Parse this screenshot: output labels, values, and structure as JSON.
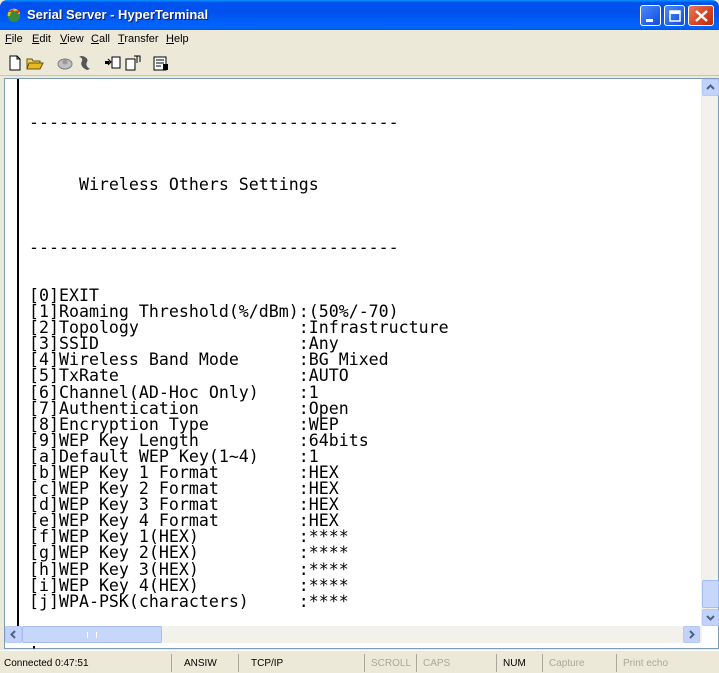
{
  "window": {
    "title": "Serial Server - HyperTerminal",
    "controls": [
      "minimize",
      "maximize",
      "close"
    ]
  },
  "menu": {
    "items": [
      {
        "label": "File",
        "accel": "F"
      },
      {
        "label": "Edit",
        "accel": "E"
      },
      {
        "label": "View",
        "accel": "V"
      },
      {
        "label": "Call",
        "accel": "C"
      },
      {
        "label": "Transfer",
        "accel": "T"
      },
      {
        "label": "Help",
        "accel": "H"
      }
    ]
  },
  "toolbar": {
    "icons": [
      "new-icon",
      "open-icon",
      "disconnect-icon",
      "dial-icon",
      "send-icon",
      "receive-icon",
      "properties-icon"
    ]
  },
  "terminal": {
    "separator": "-------------------------------------",
    "title": "     Wireless Others Settings",
    "options": [
      {
        "key": "[0]",
        "label": "EXIT",
        "value": ""
      },
      {
        "key": "[1]",
        "label": "Roaming Threshold(%/dBm)",
        "value": ":(50%/-70)"
      },
      {
        "key": "[2]",
        "label": "Topology",
        "value": ":Infrastructure"
      },
      {
        "key": "[3]",
        "label": "SSID",
        "value": ":Any"
      },
      {
        "key": "[4]",
        "label": "Wireless Band Mode",
        "value": ":BG Mixed"
      },
      {
        "key": "[5]",
        "label": "TxRate",
        "value": ":AUTO"
      },
      {
        "key": "[6]",
        "label": "Channel(AD-Hoc Only)",
        "value": ":1"
      },
      {
        "key": "[7]",
        "label": "Authentication",
        "value": ":Open"
      },
      {
        "key": "[8]",
        "label": "Encryption Type",
        "value": ":WEP"
      },
      {
        "key": "[9]",
        "label": "WEP Key Length",
        "value": ":64bits"
      },
      {
        "key": "[a]",
        "label": "Default WEP Key(1~4)",
        "value": ":1"
      },
      {
        "key": "[b]",
        "label": "WEP Key 1 Format",
        "value": ":HEX"
      },
      {
        "key": "[c]",
        "label": "WEP Key 2 Format",
        "value": ":HEX"
      },
      {
        "key": "[d]",
        "label": "WEP Key 3 Format",
        "value": ":HEX"
      },
      {
        "key": "[e]",
        "label": "WEP Key 4 Format",
        "value": ":HEX"
      },
      {
        "key": "[f]",
        "label": "WEP Key 1(HEX)",
        "value": ":****"
      },
      {
        "key": "[g]",
        "label": "WEP Key 2(HEX)",
        "value": ":****"
      },
      {
        "key": "[h]",
        "label": "WEP Key 3(HEX)",
        "value": ":****"
      },
      {
        "key": "[i]",
        "label": "WEP Key 4(HEX)",
        "value": ":****"
      },
      {
        "key": "[j]",
        "label": "WPA-PSK(characters)",
        "value": ":****"
      }
    ],
    "prompt": ":"
  },
  "status": {
    "connected": "Connected 0:47:51",
    "emulation": "ANSIW",
    "port": "TCP/IP",
    "scroll": "SCROLL",
    "caps": "CAPS",
    "num": "NUM",
    "capture": "Capture",
    "print_echo": "Print echo"
  }
}
